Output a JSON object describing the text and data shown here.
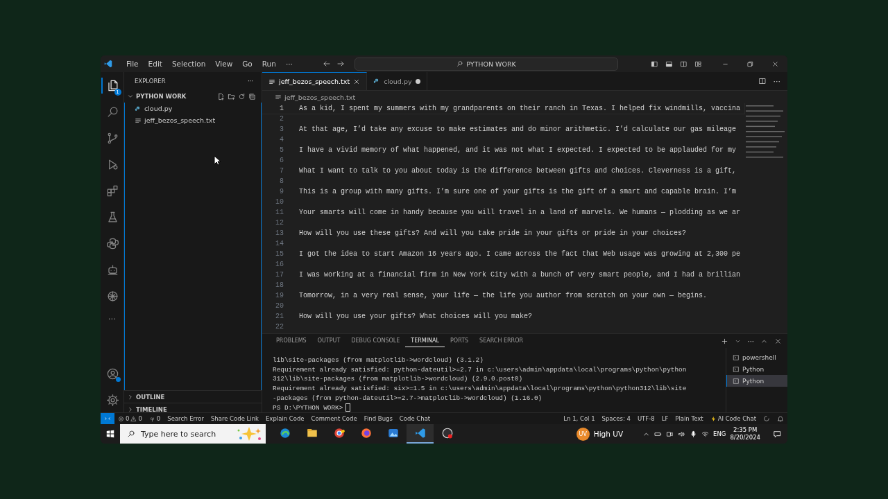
{
  "title_bar": {
    "menu": [
      "File",
      "Edit",
      "Selection",
      "View",
      "Go",
      "Run"
    ],
    "more": "···",
    "search": "PYTHON WORK"
  },
  "activity_bar": {
    "items": [
      {
        "selected": true,
        "badge": "1"
      },
      {
        "selected": false
      },
      {
        "selected": false
      },
      {
        "selected": false
      },
      {
        "selected": false
      },
      {
        "selected": false
      },
      {
        "selected": false
      },
      {
        "selected": false
      },
      {
        "selected": false
      }
    ],
    "more": "···"
  },
  "sidebar": {
    "title": "EXPLORER",
    "more": "···",
    "folder": {
      "label": "PYTHON WORK",
      "expanded": true
    },
    "files": [
      {
        "name": "cloud.py",
        "kind": "python",
        "selected": false
      },
      {
        "name": "jeff_bezos_speech.txt",
        "kind": "text",
        "selected": false
      }
    ],
    "sections": [
      {
        "label": "OUTLINE",
        "expanded": false
      },
      {
        "label": "TIMELINE",
        "expanded": false
      }
    ]
  },
  "editor": {
    "tabs": [
      {
        "label": "jeff_bezos_speech.txt",
        "kind": "text",
        "selected": true,
        "modified": false
      },
      {
        "label": "cloud.py",
        "kind": "python",
        "selected": false,
        "modified": true
      }
    ],
    "more": "···",
    "breadcrumb": "jeff_bezos_speech.txt",
    "lines": [
      {
        "number": "1",
        "text": "As a kid, I spent my summers with my grandparents on their ranch in Texas. I helped fix windmills, vaccina",
        "selected": true
      },
      {
        "number": "2",
        "selected": false
      },
      {
        "number": "3",
        "text": "At that age, I’d take any excuse to make estimates and do minor arithmetic. I’d calculate our gas mileage",
        "selected": false
      },
      {
        "number": "4",
        "selected": false
      },
      {
        "number": "5",
        "text": "I have a vivid memory of what happened, and it was not what I expected. I expected to be applauded for my",
        "selected": false
      },
      {
        "number": "6",
        "selected": false
      },
      {
        "number": "7",
        "text": "What I want to talk to you about today is the difference between gifts and choices. Cleverness is a gift,",
        "selected": false
      },
      {
        "number": "8",
        "selected": false
      },
      {
        "number": "9",
        "text": "This is a group with many gifts. I’m sure one of your gifts is the gift of a smart and capable brain. I’m",
        "selected": false
      },
      {
        "number": "10",
        "selected": false
      },
      {
        "number": "11",
        "text": "Your smarts will come in handy because you will travel in a land of marvels. We humans — plodding as we ar",
        "selected": false
      },
      {
        "number": "12",
        "selected": false
      },
      {
        "number": "13",
        "text": "How will you use these gifts? And will you take pride in your gifts or pride in your choices?",
        "selected": false
      },
      {
        "number": "14",
        "selected": false
      },
      {
        "number": "15",
        "text": "I got the idea to start Amazon 16 years ago. I came across the fact that Web usage was growing at 2,300 pe",
        "selected": false
      },
      {
        "number": "16",
        "selected": false
      },
      {
        "number": "17",
        "text": "I was working at a financial firm in New York City with a bunch of very smart people, and I had a brillian",
        "selected": false
      },
      {
        "number": "18",
        "selected": false
      },
      {
        "number": "19",
        "text": "Tomorrow, in a very real sense, your life — the life you author from scratch on your own — begins.",
        "selected": false
      },
      {
        "number": "20",
        "selected": false
      },
      {
        "number": "21",
        "text": "How will you use your gifts? What choices will you make?",
        "selected": false
      },
      {
        "number": "22",
        "selected": false
      }
    ]
  },
  "panel": {
    "tabs": [
      {
        "label": "PROBLEMS",
        "selected": false
      },
      {
        "label": "OUTPUT",
        "selected": false
      },
      {
        "label": "DEBUG CONSOLE",
        "selected": false
      },
      {
        "label": "TERMINAL",
        "selected": true
      },
      {
        "label": "PORTS",
        "selected": false
      },
      {
        "label": "SEARCH ERROR",
        "selected": false
      }
    ],
    "more": "···",
    "terminal": [
      "lib\\site-packages (from matplotlib->wordcloud) (3.1.2)",
      "Requirement already satisfied: python-dateutil>=2.7 in c:\\users\\admin\\appdata\\local\\programs\\python\\python",
      "312\\lib\\site-packages (from matplotlib->wordcloud) (2.9.0.post0)",
      "Requirement already satisfied: six>=1.5 in c:\\users\\admin\\appdata\\local\\programs\\python\\python312\\lib\\site",
      "-packages (from python-dateutil>=2.7->matplotlib->wordcloud) (1.16.0)"
    ],
    "prompt": "PS D:\\PYTHON WORK>",
    "terminals": [
      {
        "label": "powershell",
        "selected": false
      },
      {
        "label": "Python",
        "selected": false
      },
      {
        "label": "Python",
        "selected": true
      }
    ]
  },
  "status_bar": {
    "errors": "0",
    "warnings": "0",
    "ports": "0",
    "left": [
      "Search Error",
      "Share Code Link",
      "Explain Code",
      "Comment Code",
      "Find Bugs",
      "Code Chat"
    ],
    "right": [
      "Ln 1, Col 1",
      "Spaces: 4",
      "UTF-8",
      "LF",
      "Plain Text"
    ],
    "ai_chat": "AI Code Chat"
  },
  "taskbar": {
    "search_placeholder": "Type here to search",
    "apps": [
      {
        "selected": false
      },
      {
        "selected": false
      },
      {
        "selected": false
      },
      {
        "selected": false
      },
      {
        "selected": false
      },
      {
        "selected": true
      },
      {
        "selected": false
      }
    ],
    "weather": "High UV",
    "weather_badge": "UV",
    "language": "ENG",
    "time": "2:35 PM",
    "date": "8/20/2024"
  }
}
